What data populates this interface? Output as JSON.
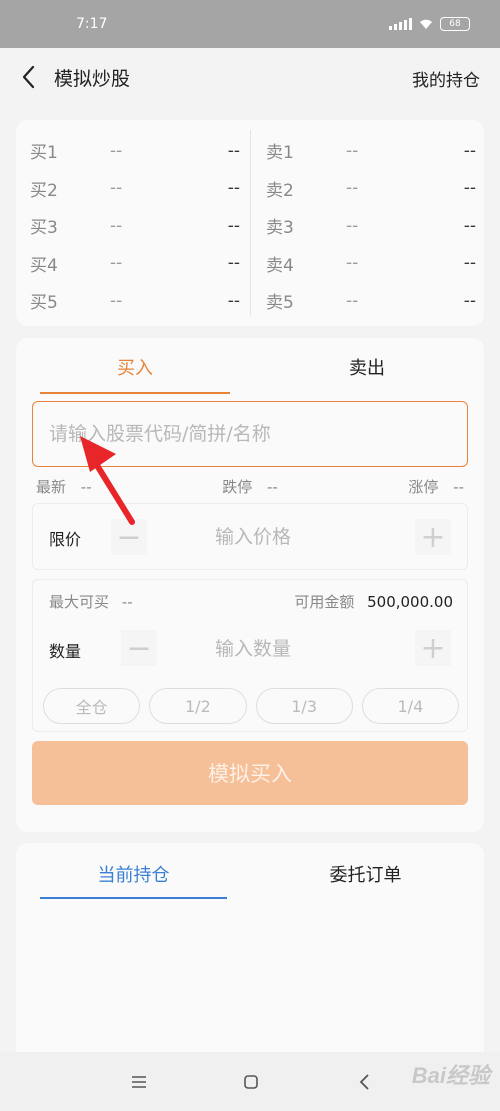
{
  "status_bar": {
    "time": "7:17",
    "battery": "68"
  },
  "header": {
    "title": "模拟炒股",
    "right_link": "我的持仓"
  },
  "order_book": {
    "bids": [
      {
        "label": "买1",
        "price": "--",
        "volume": "--"
      },
      {
        "label": "买2",
        "price": "--",
        "volume": "--"
      },
      {
        "label": "买3",
        "price": "--",
        "volume": "--"
      },
      {
        "label": "买4",
        "price": "--",
        "volume": "--"
      },
      {
        "label": "买5",
        "price": "--",
        "volume": "--"
      }
    ],
    "asks": [
      {
        "label": "卖1",
        "price": "--",
        "volume": "--"
      },
      {
        "label": "卖2",
        "price": "--",
        "volume": "--"
      },
      {
        "label": "卖3",
        "price": "--",
        "volume": "--"
      },
      {
        "label": "卖4",
        "price": "--",
        "volume": "--"
      },
      {
        "label": "卖5",
        "price": "--",
        "volume": "--"
      }
    ]
  },
  "trade": {
    "tabs": {
      "buy": "买入",
      "sell": "卖出"
    },
    "search_placeholder": "请输入股票代码/简拼/名称",
    "quote": {
      "latest_label": "最新",
      "latest_value": "--",
      "limit_down_label": "跌停",
      "limit_down_value": "--",
      "limit_up_label": "涨停",
      "limit_up_value": "--"
    },
    "price": {
      "label": "限价",
      "placeholder": "输入价格",
      "minus": "−",
      "plus": "+"
    },
    "max_buy_label": "最大可买",
    "max_buy_value": "--",
    "available_label": "可用金额",
    "available_value": "500,000.00",
    "quantity": {
      "label": "数量",
      "placeholder": "输入数量",
      "minus": "−",
      "plus": "+"
    },
    "fractions": [
      "全仓",
      "1/2",
      "1/3",
      "1/4"
    ],
    "submit_label": "模拟买入"
  },
  "positions": {
    "tabs": {
      "current": "当前持仓",
      "orders": "委托订单"
    }
  },
  "navbar": {
    "menu": "☰",
    "home": "▢",
    "back": "‹"
  },
  "watermark": "Bai经验",
  "colors": {
    "accent_orange": "#e8843a",
    "accent_blue": "#3a7fd3",
    "submit_bg": "#f5bf98",
    "annotation_red": "#e8262a"
  },
  "icons": [
    "back-chevron-icon",
    "signal-icon",
    "wifi-icon",
    "battery-icon",
    "menu-icon",
    "home-icon",
    "back-icon"
  ]
}
